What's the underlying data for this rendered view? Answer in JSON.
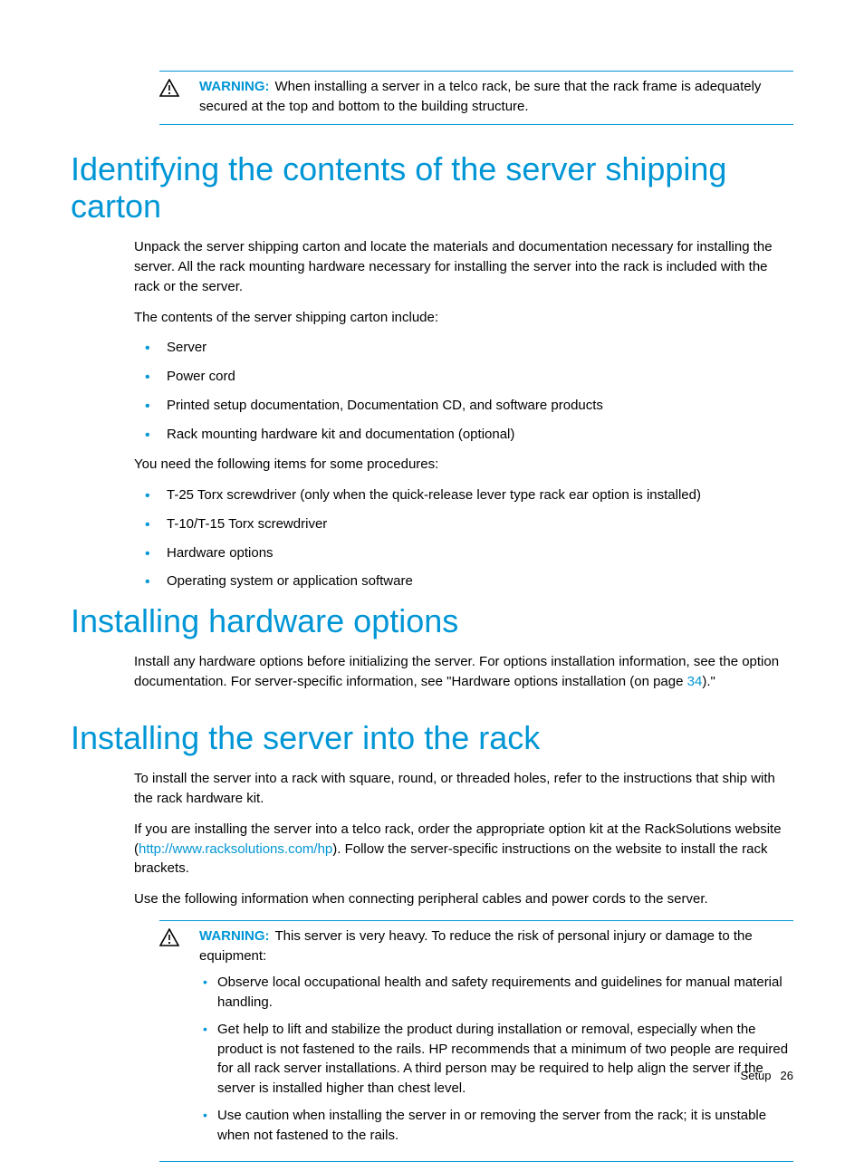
{
  "warning_top": {
    "label": "WARNING:",
    "text": "When installing a server in a telco rack, be sure that the rack frame is adequately secured at the top and bottom to the building structure."
  },
  "section1": {
    "heading": "Identifying the contents of the server shipping carton",
    "p1": "Unpack the server shipping carton and locate the materials and documentation necessary for installing the server. All the rack mounting hardware necessary for installing the server into the rack is included with the rack or the server.",
    "p2": "The contents of the server shipping carton include:",
    "list1": [
      "Server",
      "Power cord",
      "Printed setup documentation, Documentation CD, and software products",
      "Rack mounting hardware kit and documentation (optional)"
    ],
    "p3": "You need the following items for some procedures:",
    "list2": [
      "T-25 Torx screwdriver (only when the quick-release lever type rack ear option is installed)",
      "T-10/T-15 Torx screwdriver",
      "Hardware options",
      "Operating system or application software"
    ]
  },
  "section2": {
    "heading": "Installing hardware options",
    "p1_a": "Install any hardware options before initializing the server. For options installation information, see the option documentation. For server-specific information, see \"Hardware options installation (on page ",
    "p1_link": "34",
    "p1_b": ").\""
  },
  "section3": {
    "heading": "Installing the server into the rack",
    "p1": "To install the server into a rack with square, round, or threaded holes, refer to the instructions that ship with the rack hardware kit.",
    "p2_a": "If you are installing the server into a telco rack, order the appropriate option kit at the RackSolutions website (",
    "p2_link": "http://www.racksolutions.com/hp",
    "p2_b": "). Follow the server-specific instructions on the website to install the rack brackets.",
    "p3": "Use the following information when connecting peripheral cables and power cords to the server."
  },
  "warning_bot": {
    "label": "WARNING:",
    "lead": "This server is very heavy. To reduce the risk of personal injury or damage to the equipment:",
    "items": [
      "Observe local occupational health and safety requirements and guidelines for manual material handling.",
      "Get help to lift and stabilize the product during installation or removal, especially when the product is not fastened to the rails. HP recommends that a minimum of two people are required for all rack server installations. A third person may be required to help align the server if the server is installed higher than chest level.",
      "Use caution when installing the server in or removing the server from the rack; it is unstable when not fastened to the rails."
    ]
  },
  "footer": {
    "section": "Setup",
    "page": "26"
  }
}
